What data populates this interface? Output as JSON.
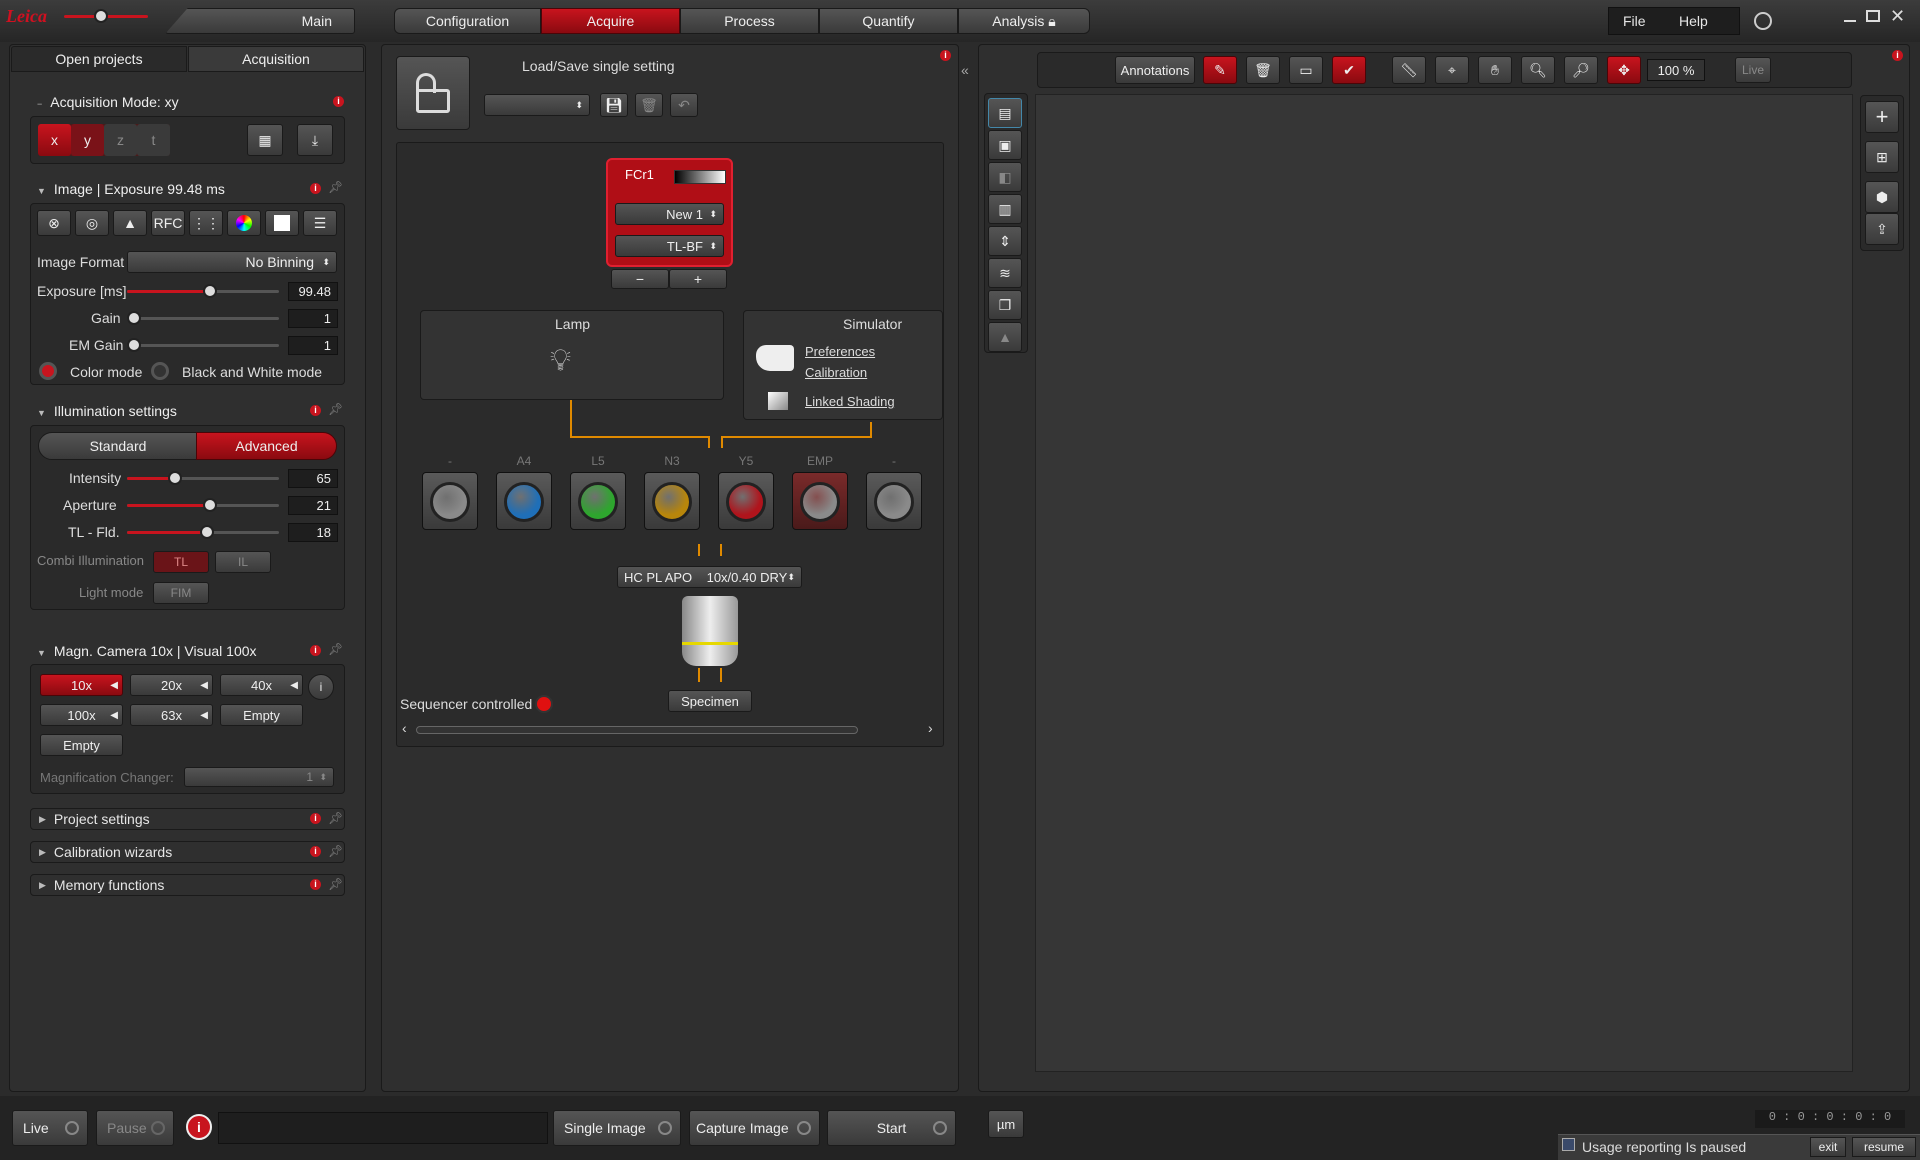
{
  "topbar": {
    "main_label": "Main",
    "workflow": [
      "Configuration",
      "Acquire",
      "Process",
      "Quantify",
      "Analysis"
    ],
    "menu": [
      "File",
      "Help"
    ]
  },
  "leftpanel": {
    "tabs": [
      "Open projects",
      "Acquisition"
    ],
    "acq_mode": "Acquisition Mode: xy",
    "axes": [
      "x",
      "y",
      "z",
      "t"
    ],
    "image_section": "Image | Exposure 99.48 ms",
    "rfc": "RFC",
    "image_format_label": "Image Format",
    "image_format_value": "No Binning",
    "exposure_label": "Exposure [ms]",
    "exposure_value": "99.48",
    "exposure_level": 0.55,
    "gain_label": "Gain",
    "gain_value": "1",
    "gain_level": 0.0,
    "emgain_label": "EM Gain",
    "emgain_value": "1",
    "emgain_level": 0.0,
    "color_mode": "Color mode",
    "bw_mode": "Black and White mode",
    "illum_section": "Illumination settings",
    "standard": "Standard",
    "advanced": "Advanced",
    "intensity_label": "Intensity",
    "intensity_value": "65",
    "intensity_level": 0.3,
    "aperture_label": "Aperture",
    "aperture_value": "21",
    "aperture_level": 0.55,
    "tlfld_label": "TL - Fld.",
    "tlfld_value": "18",
    "tlfld_level": 0.53,
    "combi_label": "Combi Illumination",
    "tl": "TL",
    "il": "IL",
    "lightmode_label": "Light mode",
    "fim": "FIM",
    "magn_section": "Magn. Camera 10x | Visual 100x",
    "mags": [
      "10x",
      "20x",
      "40x",
      "100x",
      "63x",
      "Empty",
      "Empty"
    ],
    "magchanger_label": "Magnification Changer:",
    "magchanger_value": "1",
    "collapsed": [
      "Project settings",
      "Calibration wizards",
      "Memory functions"
    ]
  },
  "center": {
    "loadsave": "Load/Save single setting",
    "fc_title": "FCr1",
    "fc_new": "New 1",
    "fc_mode": "TL-BF",
    "lamp": "Lamp",
    "simulator": "Simulator",
    "links": [
      "Preferences",
      "Calibration",
      "Linked Shading"
    ],
    "filters": [
      {
        "label": "-",
        "color": "#8a8a8a"
      },
      {
        "label": "A4",
        "color": "#1f6fb8"
      },
      {
        "label": "L5",
        "color": "#2ea62e"
      },
      {
        "label": "N3",
        "color": "#b8860b"
      },
      {
        "label": "Y5",
        "color": "#b0141c"
      },
      {
        "label": "EMP",
        "color": "#8a8a8a"
      },
      {
        "label": "-",
        "color": "#8a8a8a"
      }
    ],
    "objective": "HC PL APO    10x/0.40 DRY",
    "specimen": "Specimen",
    "sequencer": "Sequencer controlled"
  },
  "viewer": {
    "annotations": "Annotations",
    "zoom": "100 %",
    "live": "Live",
    "unit": "µm",
    "timecode": "0 : 0 : 0 : 0 : 0"
  },
  "bottom": {
    "live": "Live",
    "pause": "Pause",
    "single": "Single Image",
    "capture": "Capture Image",
    "start": "Start"
  },
  "usage": {
    "text": "Usage reporting Is paused",
    "exit": "exit",
    "resume": "resume"
  }
}
